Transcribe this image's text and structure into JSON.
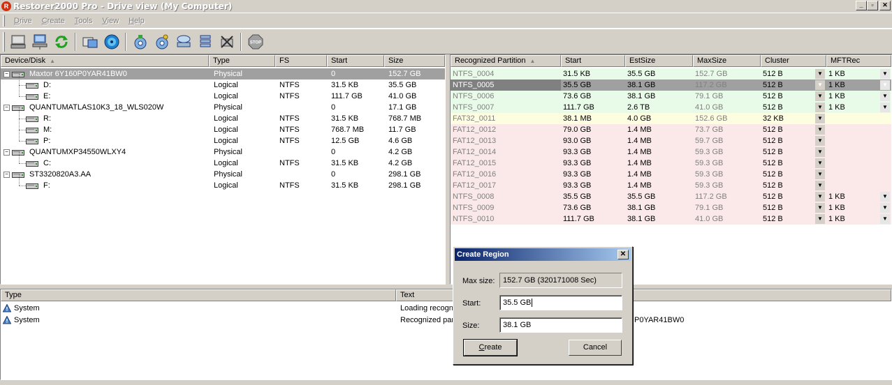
{
  "window": {
    "title": "Restorer2000 Pro - Drive view (My Computer)",
    "app_icon_glyph": "R",
    "btn_minimize": "_",
    "btn_restore": "▫",
    "btn_close": "✕"
  },
  "menu": {
    "items": [
      {
        "accel": "D",
        "rest": "rive"
      },
      {
        "accel": "C",
        "rest": "reate"
      },
      {
        "accel": "T",
        "rest": "ools"
      },
      {
        "accel": "V",
        "rest": "iew"
      },
      {
        "accel": "H",
        "rest": "elp"
      }
    ]
  },
  "toolbar": {
    "icons": [
      "drive-icon",
      "network-drive-icon",
      "refresh-icon",
      "open-image-icon",
      "scan-icon",
      "disk-search-icon",
      "disk-settings-icon",
      "region-icon",
      "stack-icon",
      "delete-icon",
      "stop-icon"
    ],
    "stop_label": "STOP"
  },
  "drives_panel": {
    "headers": {
      "device": "Device/Disk",
      "type": "Type",
      "fs": "FS",
      "start": "Start",
      "size": "Size"
    },
    "rows": [
      {
        "name": "Maxtor 6Y160P0YAR41BW0",
        "type": "Physical",
        "fs": "",
        "start": "0",
        "size": "152.7 GB"
      },
      {
        "name": "D:",
        "type": "Logical",
        "fs": "NTFS",
        "start": "31.5 KB",
        "size": "35.5 GB"
      },
      {
        "name": "E:",
        "type": "Logical",
        "fs": "NTFS",
        "start": "111.7 GB",
        "size": "41.0 GB"
      },
      {
        "name": "QUANTUMATLAS10K3_18_WLS020W",
        "type": "Physical",
        "fs": "",
        "start": "0",
        "size": "17.1 GB"
      },
      {
        "name": "R:",
        "type": "Logical",
        "fs": "NTFS",
        "start": "31.5 KB",
        "size": "768.7 MB"
      },
      {
        "name": "M:",
        "type": "Logical",
        "fs": "NTFS",
        "start": "768.7 MB",
        "size": "11.7 GB"
      },
      {
        "name": "P:",
        "type": "Logical",
        "fs": "NTFS",
        "start": "12.5 GB",
        "size": "4.6 GB"
      },
      {
        "name": "QUANTUMXP34550WLXY4",
        "type": "Physical",
        "fs": "",
        "start": "0",
        "size": "4.2 GB"
      },
      {
        "name": "C:",
        "type": "Logical",
        "fs": "NTFS",
        "start": "31.5 KB",
        "size": "4.2 GB"
      },
      {
        "name": "ST3320820A3.AA",
        "type": "Physical",
        "fs": "",
        "start": "0",
        "size": "298.1 GB"
      },
      {
        "name": "F:",
        "type": "Logical",
        "fs": "NTFS",
        "start": "31.5 KB",
        "size": "298.1 GB"
      }
    ]
  },
  "partitions_panel": {
    "headers": {
      "name": "Recognized Partition",
      "start": "Start",
      "estsize": "EstSize",
      "maxsize": "MaxSize",
      "cluster": "Cluster",
      "mftrec": "MFTRec"
    },
    "rows": [
      {
        "name": "NTFS_0004",
        "start": "31.5 KB",
        "estsize": "35.5 GB",
        "maxsize": "152.7 GB",
        "cluster": "512 B",
        "mftrec": "1 KB",
        "group": "green"
      },
      {
        "name": "NTFS_0005",
        "start": "35.5 GB",
        "estsize": "38.1 GB",
        "maxsize": "117.2 GB",
        "cluster": "512 B",
        "mftrec": "1 KB",
        "group": "green"
      },
      {
        "name": "NTFS_0006",
        "start": "73.6 GB",
        "estsize": "38.1 GB",
        "maxsize": "79.1 GB",
        "cluster": "512 B",
        "mftrec": "1 KB",
        "group": "green"
      },
      {
        "name": "NTFS_0007",
        "start": "111.7 GB",
        "estsize": "2.6 TB",
        "maxsize": "41.0 GB",
        "cluster": "512 B",
        "mftrec": "1 KB",
        "group": "green"
      },
      {
        "name": "FAT32_0011",
        "start": "38.1 MB",
        "estsize": "4.0 GB",
        "maxsize": "152.6 GB",
        "cluster": "32 KB",
        "mftrec": "",
        "group": "yellow"
      },
      {
        "name": "FAT12_0012",
        "start": "79.0 GB",
        "estsize": "1.4 MB",
        "maxsize": "73.7 GB",
        "cluster": "512 B",
        "mftrec": "",
        "group": "red"
      },
      {
        "name": "FAT12_0013",
        "start": "93.0 GB",
        "estsize": "1.4 MB",
        "maxsize": "59.7 GB",
        "cluster": "512 B",
        "mftrec": "",
        "group": "red"
      },
      {
        "name": "FAT12_0014",
        "start": "93.3 GB",
        "estsize": "1.4 MB",
        "maxsize": "59.3 GB",
        "cluster": "512 B",
        "mftrec": "",
        "group": "red"
      },
      {
        "name": "FAT12_0015",
        "start": "93.3 GB",
        "estsize": "1.4 MB",
        "maxsize": "59.3 GB",
        "cluster": "512 B",
        "mftrec": "",
        "group": "red"
      },
      {
        "name": "FAT12_0016",
        "start": "93.3 GB",
        "estsize": "1.4 MB",
        "maxsize": "59.3 GB",
        "cluster": "512 B",
        "mftrec": "",
        "group": "red"
      },
      {
        "name": "FAT12_0017",
        "start": "93.3 GB",
        "estsize": "1.4 MB",
        "maxsize": "59.3 GB",
        "cluster": "512 B",
        "mftrec": "",
        "group": "red"
      },
      {
        "name": "NTFS_0008",
        "start": "35.5 GB",
        "estsize": "35.5 GB",
        "maxsize": "117.2 GB",
        "cluster": "512 B",
        "mftrec": "1 KB",
        "group": "red"
      },
      {
        "name": "NTFS_0009",
        "start": "73.6 GB",
        "estsize": "38.1 GB",
        "maxsize": "79.1 GB",
        "cluster": "512 B",
        "mftrec": "1 KB",
        "group": "red"
      },
      {
        "name": "NTFS_0010",
        "start": "111.7 GB",
        "estsize": "38.1 GB",
        "maxsize": "41.0 GB",
        "cluster": "512 B",
        "mftrec": "1 KB",
        "group": "red"
      }
    ]
  },
  "log_panel": {
    "headers": {
      "type": "Type",
      "text": "Text"
    },
    "rows": [
      {
        "type": "System",
        "text_left": "Loading recogni",
        "text_right": ""
      },
      {
        "type": "System",
        "text_left": "Recognized part",
        "text_right": "P0YAR41BW0"
      }
    ]
  },
  "dialog": {
    "title": "Create Region",
    "close_glyph": "✕",
    "max_size_label": "Max size:",
    "max_size_value": "152.7 GB (320171008 Sec)",
    "start_label": "Start:",
    "start_value": "35.5 GB",
    "size_label": "Size:",
    "size_value": "38.1 GB",
    "create_accel": "C",
    "create_rest": "reate",
    "cancel_label": "Cancel"
  },
  "colors": {
    "chrome": "#d4d0c8",
    "group_green": "#e8fbe8",
    "group_yellow": "#fdfde0",
    "group_red": "#fbe8e8",
    "title_gradient_start": "#0a246a",
    "title_gradient_end": "#a6caf0"
  }
}
